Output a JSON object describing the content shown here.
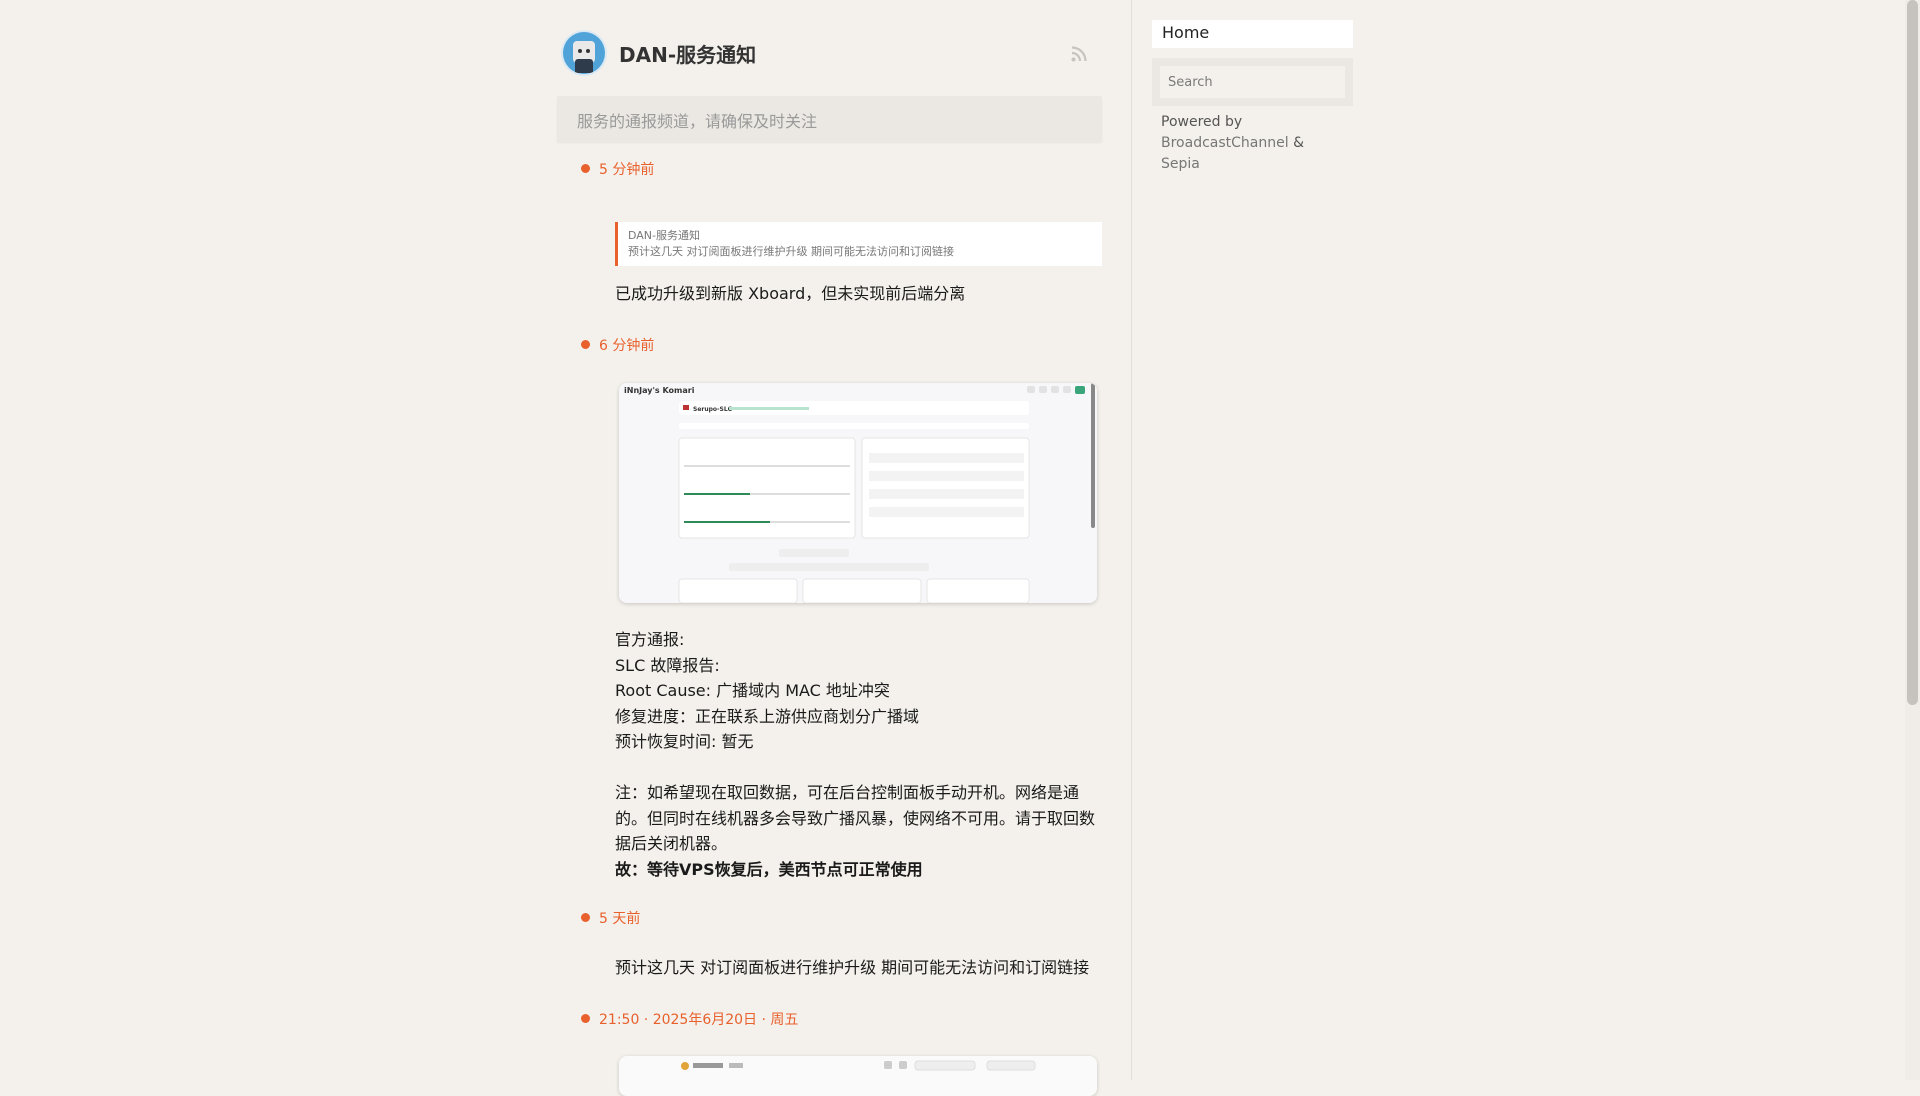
{
  "channel": {
    "title": "DAN-服务通知",
    "description": "服务的通报频道，请确保及时关注"
  },
  "posts": [
    {
      "time": "5 分钟前",
      "reply": {
        "author": "DAN-服务通知",
        "text": "预计这几天 对订阅面板进行维护升级 期间可能无法访问和订阅链接"
      },
      "text": "已成功升级到新版 Xboard，但未实现前后端分离"
    },
    {
      "time": "6 分钟前",
      "image": {
        "brand": "iNnJay's Komari",
        "server": "Serupo-SLC"
      },
      "lines": [
        "官方通报:",
        "SLC 故障报告:",
        "Root Cause: 广播域内 MAC 地址冲突",
        "修复进度：正在联系上游供应商划分广播域",
        "预计恢复时间: 暂无",
        "",
        "注：如希望现在取回数据，可在后台控制面板手动开机。网络是通的。但同时在线机器多会导致广播风暴，使网络不可用。请于取回数据后关闭机器。"
      ],
      "bold": "故：等待VPS恢复后，美西节点可正常使用"
    },
    {
      "time": "5 天前",
      "text": "预计这几天 对订阅面板进行维护升级 期间可能无法访问和订阅链接"
    },
    {
      "time": "21:50 · 2025年6月20日 · 周五"
    }
  ],
  "sidebar": {
    "home": "Home",
    "search_placeholder": "Search",
    "powered_prefix": "Powered by",
    "powered_link1": "BroadcastChannel",
    "powered_amp": " & ",
    "powered_link2": "Sepia"
  },
  "colors": {
    "accent": "#e8602c",
    "background": "#f4f1ec"
  },
  "icons": [
    "rss-icon",
    "avatar"
  ]
}
